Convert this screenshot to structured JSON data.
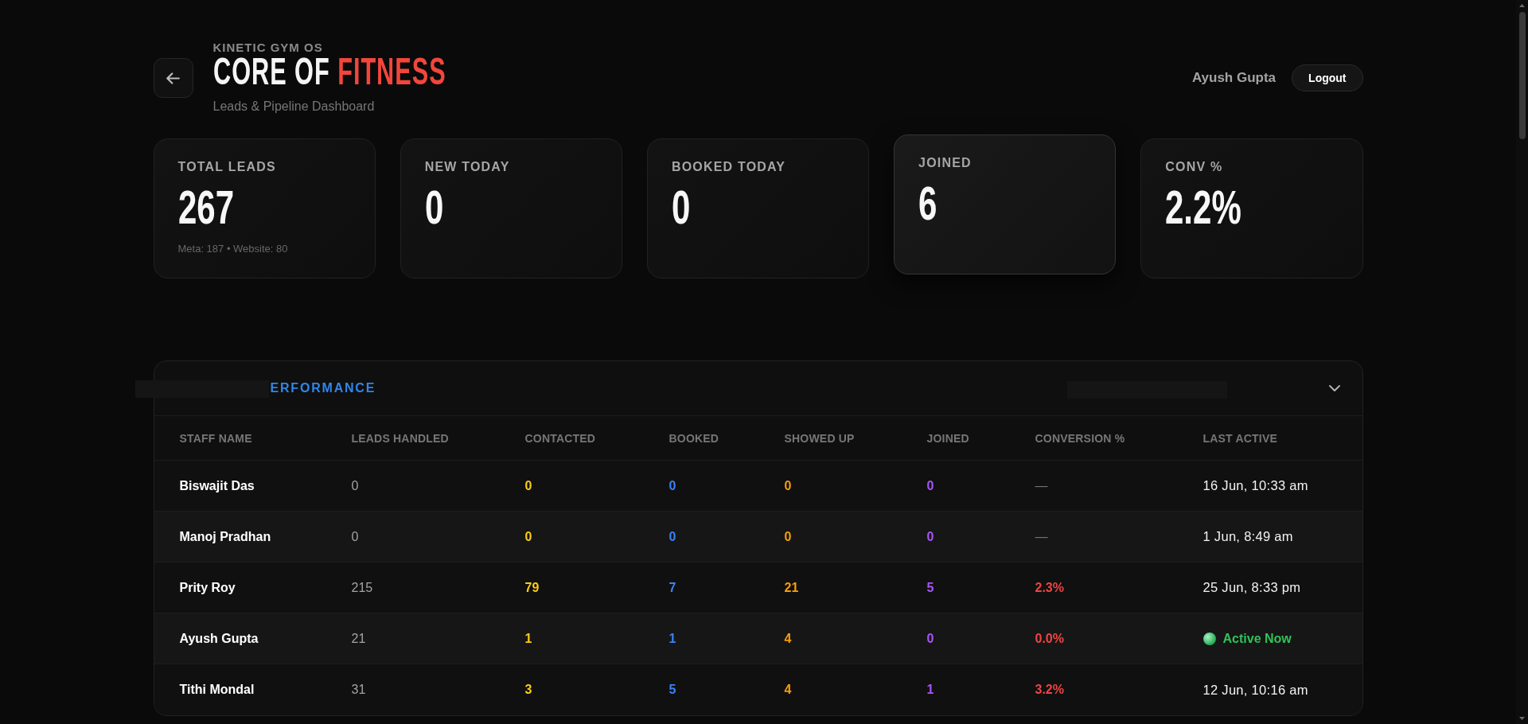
{
  "header": {
    "eyebrow": "KINETIC GYM OS",
    "title": [
      {
        "text": "CORE OF",
        "accent": false
      },
      {
        "text": "FITNESS",
        "accent": true
      }
    ],
    "subtitle": "Leads & Pipeline Dashboard"
  },
  "user": {
    "name": "Ayush Gupta",
    "logout": "Logout"
  },
  "stats": [
    {
      "label": "TOTAL LEADS",
      "value": "267",
      "note": "Meta: 187 • Website: 80",
      "hovered": false
    },
    {
      "label": "NEW TODAY",
      "value": "0",
      "hovered": false
    },
    {
      "label": "BOOKED TODAY",
      "value": "0",
      "hovered": false
    },
    {
      "label": "JOINED",
      "value": "6",
      "hovered": true
    },
    {
      "label": "CONV %",
      "value": "2.2%",
      "hovered": false
    }
  ],
  "performance": {
    "title": "ERFORMANCE",
    "expanded": true,
    "columns": [
      "STAFF NAME",
      "LEADS HANDLED",
      "CONTACTED",
      "BOOKED",
      "SHOWED UP",
      "JOINED",
      "CONVERSION %",
      "LAST ACTIVE"
    ],
    "rows": [
      {
        "name": "Biswajit Das",
        "leads_handled": "0",
        "contacted": "0",
        "booked": "0",
        "showed_up": "0",
        "joined": "0",
        "conversion": {
          "kind": "none",
          "text": "—"
        },
        "last_active": {
          "kind": "time",
          "text": "16 Jun, 10:33 am"
        }
      },
      {
        "name": "Manoj Pradhan",
        "leads_handled": "0",
        "contacted": "0",
        "booked": "0",
        "showed_up": "0",
        "joined": "0",
        "conversion": {
          "kind": "none",
          "text": "—"
        },
        "last_active": {
          "kind": "time",
          "text": "1 Jun, 8:49 am"
        }
      },
      {
        "name": "Prity Roy",
        "leads_handled": "215",
        "contacted": "79",
        "booked": "7",
        "showed_up": "21",
        "joined": "5",
        "conversion": {
          "kind": "rate",
          "text": "2.3%"
        },
        "last_active": {
          "kind": "time",
          "text": "25 Jun, 8:33 pm"
        }
      },
      {
        "name": "Ayush Gupta",
        "leads_handled": "21",
        "contacted": "1",
        "booked": "1",
        "showed_up": "4",
        "joined": "0",
        "conversion": {
          "kind": "rate",
          "text": "0.0%"
        },
        "last_active": {
          "kind": "online",
          "text": "Active Now"
        }
      },
      {
        "name": "Tithi Mondal",
        "leads_handled": "31",
        "contacted": "3",
        "booked": "5",
        "showed_up": "4",
        "joined": "1",
        "conversion": {
          "kind": "rate",
          "text": "3.2%"
        },
        "last_active": {
          "kind": "time",
          "text": "12 Jun, 10:16 am"
        }
      }
    ]
  }
}
